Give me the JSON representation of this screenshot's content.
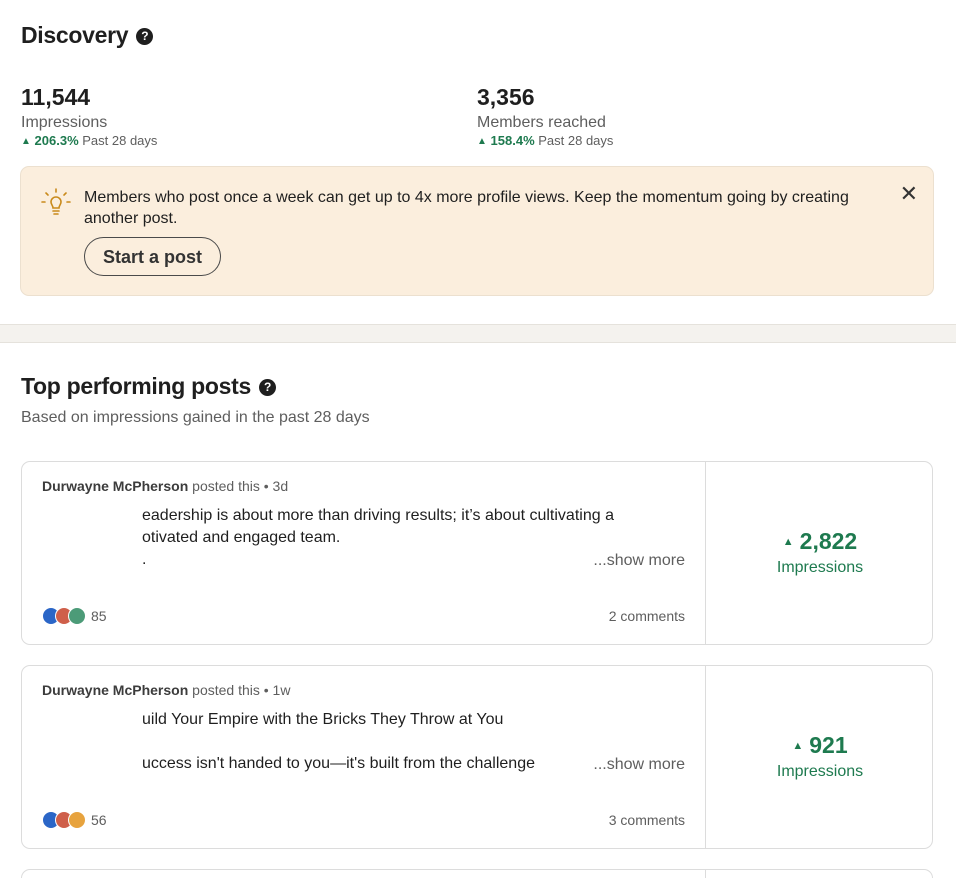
{
  "discovery": {
    "title": "Discovery",
    "help_icon": "?",
    "impressions": {
      "value": "11,544",
      "label": "Impressions",
      "trend_arrow": "▲",
      "trend_pct": "206.3%",
      "trend_period": "Past 28 days"
    },
    "members": {
      "value": "3,356",
      "label": "Members reached",
      "trend_arrow": "▲",
      "trend_pct": "158.4%",
      "trend_period": "Past 28 days"
    },
    "banner": {
      "icon": "lightbulb-icon",
      "message": "Members who post once a week can get up to 4x more profile views. Keep the momentum going by creating another post.",
      "button_label": "Start a post",
      "close_glyph": "✕"
    }
  },
  "top_posts": {
    "title": "Top performing posts",
    "help_icon": "?",
    "subtitle": "Based on impressions gained in the past 28 days",
    "posts": [
      {
        "author": "Durwayne McPherson",
        "meta": " posted this • 3d",
        "line1": "eadership is about more than driving results; it’s about cultivating a",
        "line2": "otivated and engaged team.",
        "line3": ".",
        "show_more": "...show more",
        "reaction_count": "85",
        "comments": "2 comments",
        "impressions_arrow": "▲",
        "impressions": "2,822",
        "impressions_label": "Impressions"
      },
      {
        "author": "Durwayne McPherson",
        "meta": " posted this • 1w",
        "line1": "uild Your Empire with the Bricks They Throw at You",
        "line2": "",
        "line3": "uccess isn't handed to you—it's built from the challenge",
        "show_more": "...show more",
        "reaction_count": "56",
        "comments": "3 comments",
        "impressions_arrow": "▲",
        "impressions": "921",
        "impressions_label": "Impressions"
      }
    ]
  },
  "colors": {
    "positive": "#1e7a4f",
    "banner_bg": "#fbeedd"
  }
}
